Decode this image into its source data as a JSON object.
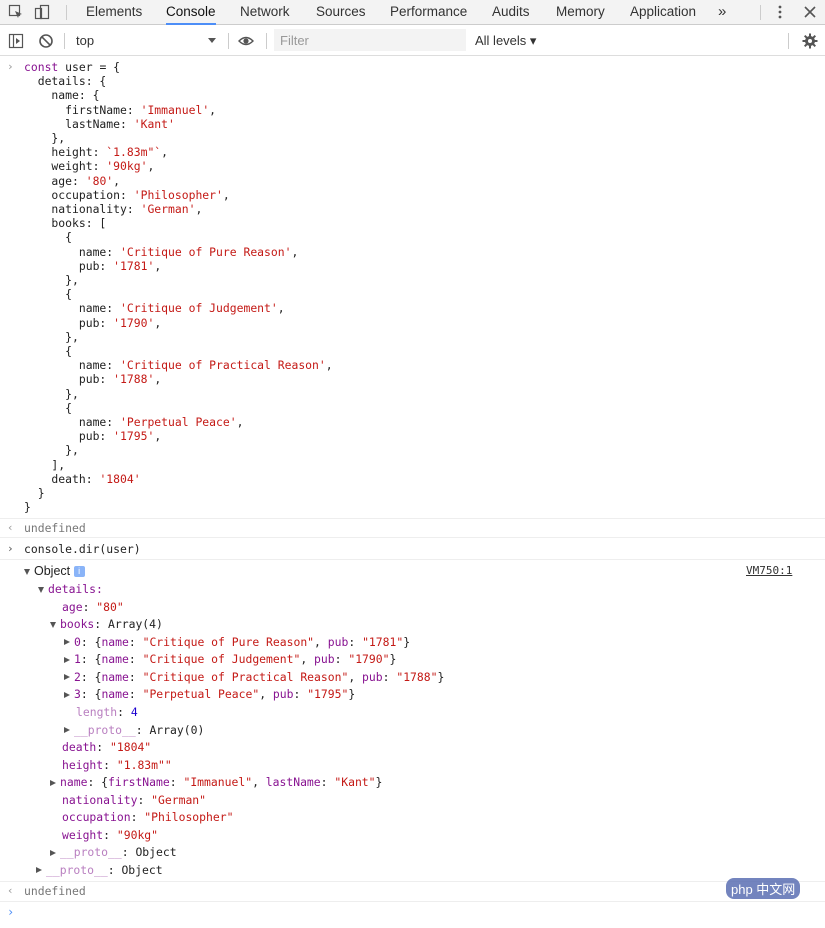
{
  "tabs": [
    {
      "label": "Elements",
      "active": false
    },
    {
      "label": "Console",
      "active": true
    },
    {
      "label": "Network",
      "active": false
    },
    {
      "label": "Sources",
      "active": false
    },
    {
      "label": "Performance",
      "active": false
    },
    {
      "label": "Audits",
      "active": false
    },
    {
      "label": "Memory",
      "active": false
    },
    {
      "label": "Application",
      "active": false
    }
  ],
  "more_tabs": "»",
  "toolbar": {
    "context": "top",
    "filter_placeholder": "Filter",
    "levels": "All levels ▾"
  },
  "input_code": [
    "const user = {",
    "  details: {",
    "    name: {",
    "      firstName: 'Immanuel',",
    "      lastName: 'Kant'",
    "    },",
    "    height: `1.83m\"`,",
    "    weight: '90kg',",
    "    age: '80',",
    "    occupation: 'Philosopher',",
    "    nationality: 'German',",
    "    books: [",
    "      {",
    "        name: 'Critique of Pure Reason',",
    "        pub: '1781',",
    "      },",
    "      {",
    "        name: 'Critique of Judgement',",
    "        pub: '1790',",
    "      },",
    "      {",
    "        name: 'Critique of Practical Reason',",
    "        pub: '1788',",
    "      },",
    "      {",
    "        name: 'Perpetual Peace',",
    "        pub: '1795',",
    "      },",
    "    ],",
    "    death: '1804'",
    "  }",
    "}"
  ],
  "result1": "undefined",
  "command2": "console.dir(user)",
  "source_link": "VM750:1",
  "tree": {
    "root_label": "Object",
    "details_label": "details:",
    "age": {
      "key": "age",
      "value": "\"80\""
    },
    "books": {
      "key": "books",
      "value": "Array(4)"
    },
    "book_items": [
      {
        "index": "0",
        "name": "Critique of Pure Reason",
        "pub": "1781"
      },
      {
        "index": "1",
        "name": "Critique of Judgement",
        "pub": "1790"
      },
      {
        "index": "2",
        "name": "Critique of Practical Reason",
        "pub": "1788"
      },
      {
        "index": "3",
        "name": "Perpetual Peace",
        "pub": "1795"
      }
    ],
    "length": {
      "key": "length",
      "value": "4"
    },
    "books_proto": {
      "key": "__proto__",
      "value": "Array(0)"
    },
    "death": {
      "key": "death",
      "value": "\"1804\""
    },
    "height": {
      "key": "height",
      "value": "\"1.83m\"\""
    },
    "name": {
      "key": "name",
      "firstName": "Immanuel",
      "lastName": "Kant"
    },
    "nationality": {
      "key": "nationality",
      "value": "\"German\""
    },
    "occupation": {
      "key": "occupation",
      "value": "\"Philosopher\""
    },
    "weight": {
      "key": "weight",
      "value": "\"90kg\""
    },
    "details_proto": {
      "key": "__proto__",
      "value": "Object"
    },
    "root_proto": {
      "key": "__proto__",
      "value": "Object"
    }
  },
  "result2": "undefined",
  "watermark": "php 中文网"
}
